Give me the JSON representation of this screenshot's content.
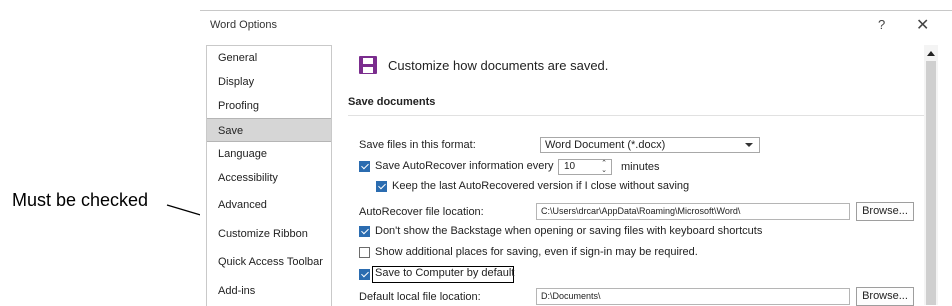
{
  "annotation": {
    "text": "Must be checked"
  },
  "window": {
    "title": "Word Options",
    "help_glyph": "?",
    "close_glyph": "✕"
  },
  "nav": {
    "items": [
      {
        "label": "General"
      },
      {
        "label": "Display"
      },
      {
        "label": "Proofing"
      },
      {
        "label": "Save",
        "selected": true
      },
      {
        "label": "Language"
      },
      {
        "label": "Accessibility"
      },
      {
        "label": "Advanced"
      },
      {
        "label": "Customize Ribbon"
      },
      {
        "label": "Quick Access Toolbar"
      },
      {
        "label": "Add-ins"
      }
    ]
  },
  "header": {
    "icon": "save-icon",
    "text": "Customize how documents are saved."
  },
  "save_documents": {
    "title": "Save documents",
    "format_label": "Save files in this format:",
    "format_value": "Word Document (*.docx)",
    "autorecover_label": "Save AutoRecover information every",
    "autorecover_checked": true,
    "autorecover_minutes": "10",
    "minutes_label": "minutes",
    "keep_last_label": "Keep the last AutoRecovered version if I close without saving",
    "keep_last_checked": true,
    "autorecover_location_label": "AutoRecover file location:",
    "autorecover_location_value": "C:\\Users\\drcar\\AppData\\Roaming\\Microsoft\\Word\\",
    "browse_label": "Browse...",
    "dont_show_backstage_label": "Don't show the Backstage when opening or saving files with keyboard shortcuts",
    "dont_show_backstage_checked": true,
    "show_additional_places_label": "Show additional places for saving, even if sign-in may be required.",
    "show_additional_places_checked": false,
    "save_to_computer_label": "Save to Computer by default",
    "save_to_computer_checked": true,
    "default_local_label": "Default local file location:",
    "default_local_value": "D:\\Documents\\",
    "browse_label_2": "Browse..."
  },
  "colors": {
    "checkbox_accent": "#2b6cb0",
    "save_icon": "#7b2d8e",
    "selected_nav": "#d6d6d6"
  }
}
